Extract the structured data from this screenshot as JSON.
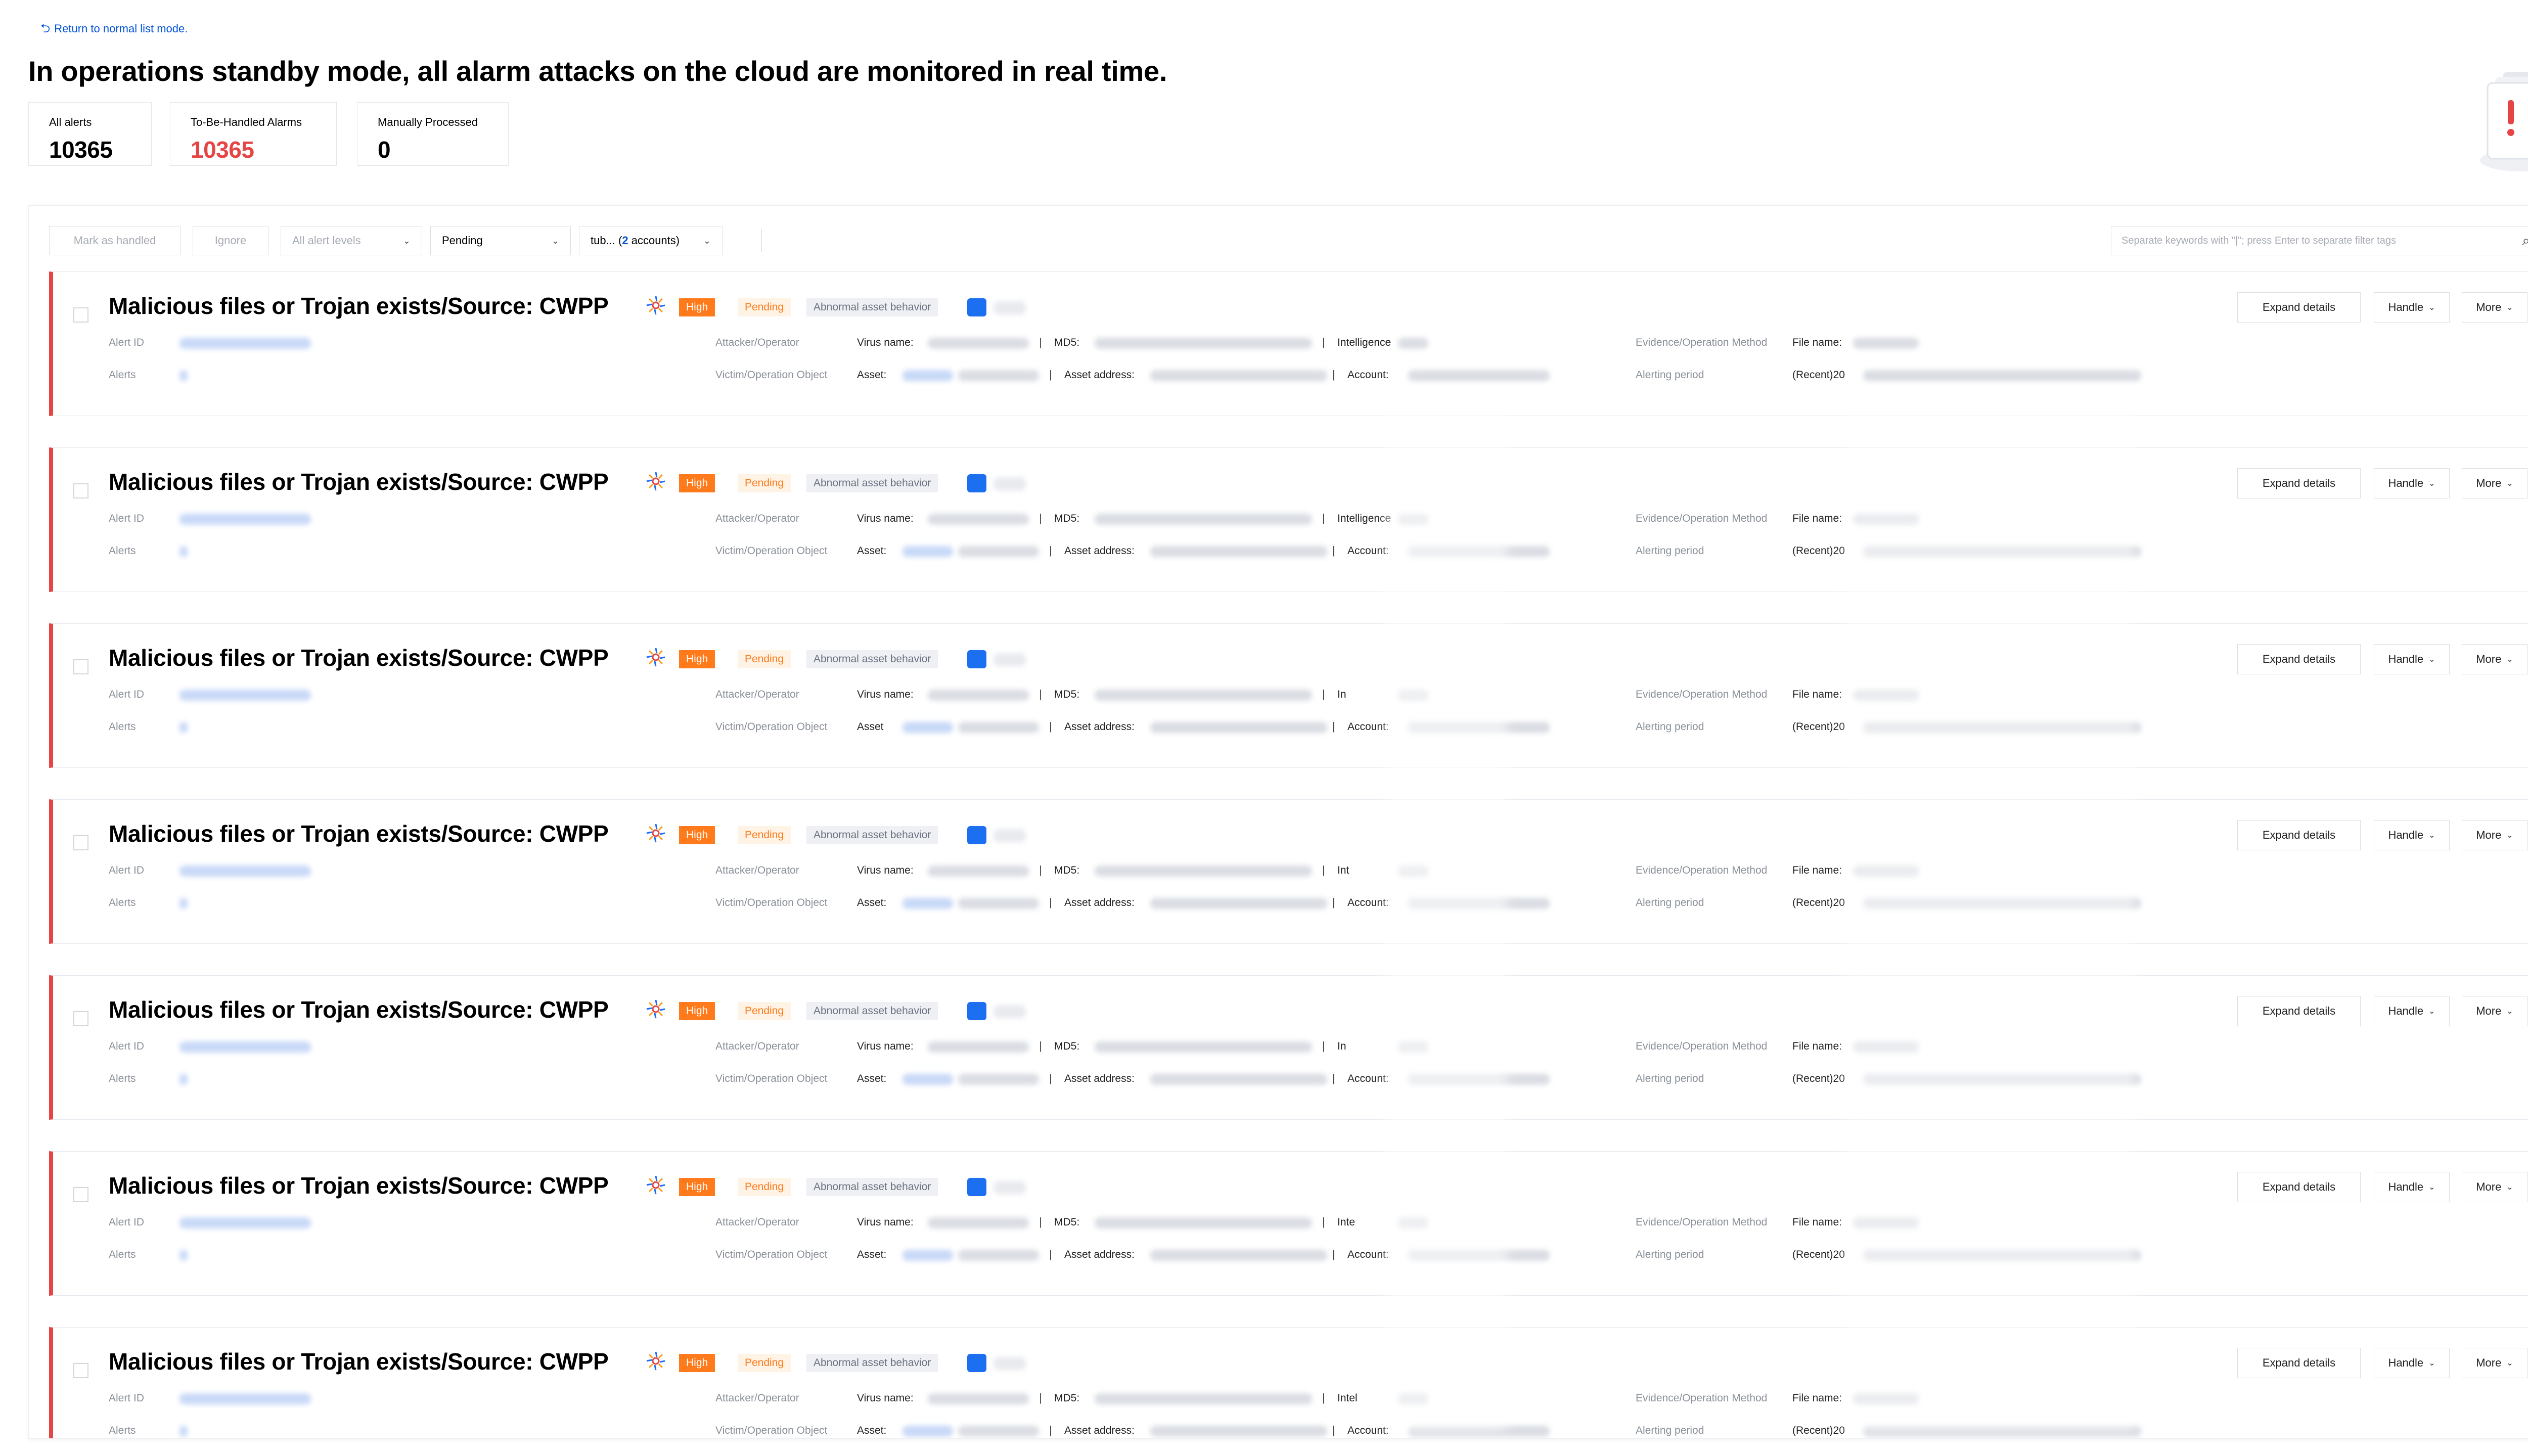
{
  "header": {
    "return_link": "Return to normal list mode.",
    "title": "In operations standby mode, all alarm attacks on the cloud are monitored in real time."
  },
  "stats": [
    {
      "label": "All alerts",
      "value": "10365"
    },
    {
      "label": "To-Be-Handled Alarms",
      "value": "10365"
    },
    {
      "label": "Manually Processed",
      "value": "0"
    }
  ],
  "toolbar": {
    "mark_handled": "Mark as handled",
    "ignore": "Ignore",
    "alert_levels": "All alert levels",
    "status": "Pending",
    "account_prefix": "tub... (",
    "account_count": "2",
    "account_suffix": " accounts)",
    "search_placeholder": "Separate keywords with \"|\"; press Enter to separate filter tags"
  },
  "card_common": {
    "title": "Malicious files or Trojan exists/Source: CWPP",
    "level": "High",
    "status": "Pending",
    "category": "Abnormal asset behavior",
    "alert_id_label": "Alert ID",
    "alerts_label": "Alerts",
    "attacker_label": "Attacker/Operator",
    "victim_label": "Victim/Operation Object",
    "virus_name_label": "Virus name:",
    "md5_label": "MD5:",
    "intelligence_label": "Intelligence",
    "asset_label": "Asset:",
    "asset_address_label": "Asset address:",
    "account_label": "Account:",
    "evidence_label": "Evidence/Operation Method",
    "file_name_label": "File name:",
    "alerting_period_label": "Alerting period",
    "recent_label": "(Recent)20",
    "expand": "Expand details",
    "handle": "Handle",
    "more": "More"
  },
  "cards": [
    {
      "intel": "Intelligence",
      "asset": "Asset:"
    },
    {
      "intel": "Intelligence",
      "asset": "Asset:"
    },
    {
      "intel": "In",
      "asset": "Asset"
    },
    {
      "intel": "Int",
      "asset": "Asset:"
    },
    {
      "intel": "In",
      "asset": "Asset:"
    },
    {
      "intel": "Inte",
      "asset": "Asset:"
    },
    {
      "intel": "Intel",
      "asset": "Asset:"
    }
  ],
  "colors": {
    "accent_blue": "#0052d9",
    "alert_red": "#e54545",
    "high_orange": "#ff7a1a"
  }
}
